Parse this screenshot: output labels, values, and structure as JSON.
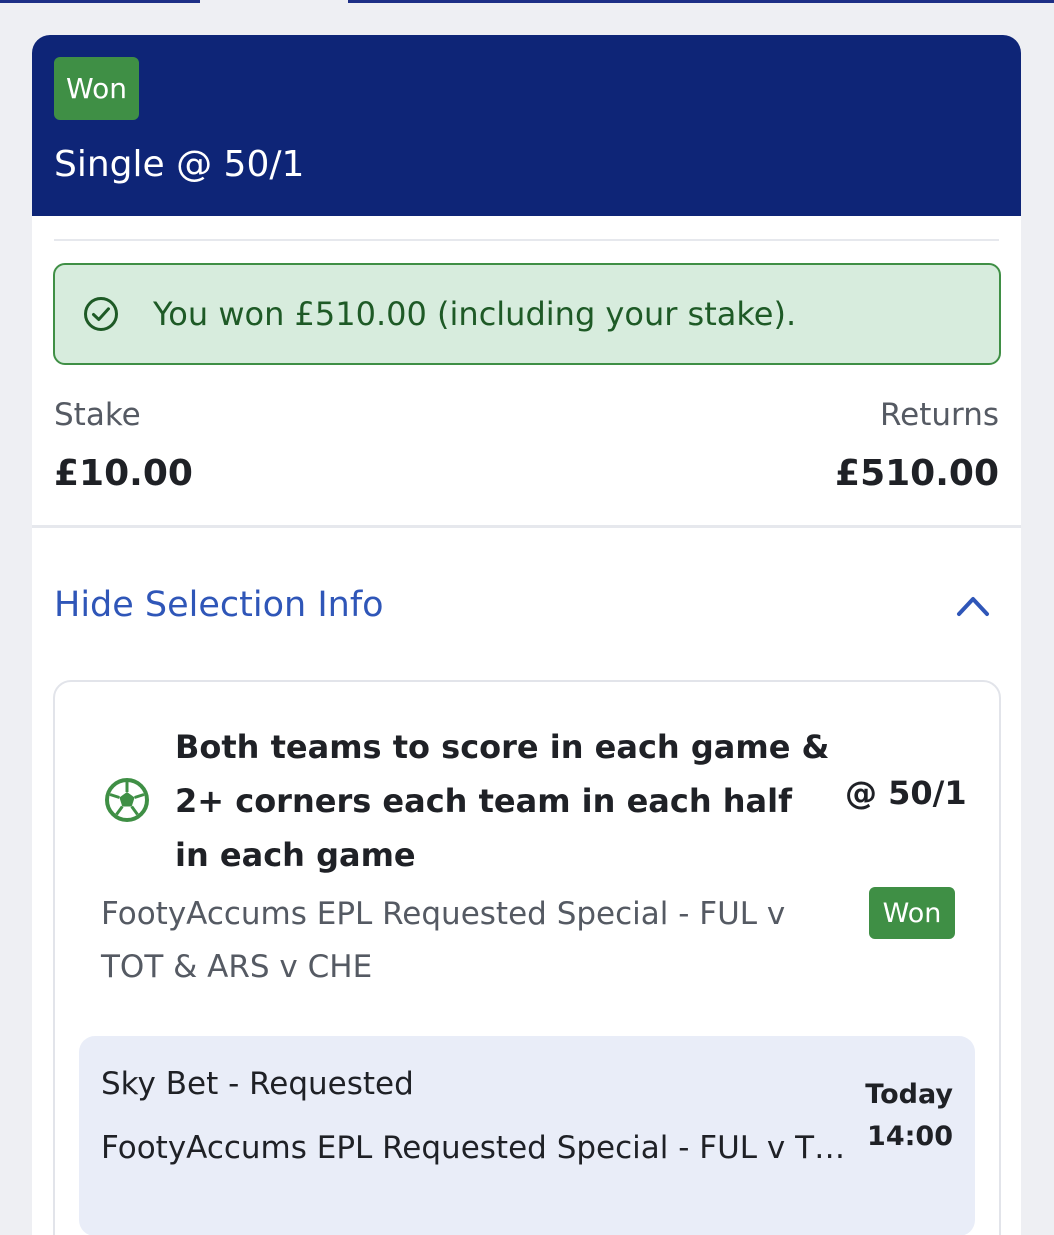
{
  "header": {
    "status_badge": "Won",
    "title": "Single @ 50/1"
  },
  "win_message": "You won £510.00 (including your stake).",
  "summary": {
    "stake_label": "Stake",
    "stake_value": "£10.00",
    "returns_label": "Returns",
    "returns_value": "£510.00"
  },
  "toggle": {
    "label": "Hide Selection Info"
  },
  "selection": {
    "market": "Both teams to score in each game & 2+ corners each team in each half in each game",
    "odds": "@ 50/1",
    "event": "FootyAccums EPL Requested Special - FUL v TOT & ARS v CHE",
    "status_badge": "Won",
    "details": {
      "provider": "Sky Bet - Requested",
      "event": "FootyAccums EPL Requested Special - FUL v TOT & ARS v CHE",
      "day": "Today",
      "time": "14:00"
    }
  },
  "icons": {
    "check": "check-circle-icon",
    "collapse": "chevron-up-icon",
    "sport": "football-icon"
  },
  "colors": {
    "header_bg": "#0e2577",
    "won_green": "#3f8f45",
    "win_banner_bg": "#d7ecdd",
    "link_blue": "#2f56b8",
    "info_box_bg": "#e9edf8"
  }
}
